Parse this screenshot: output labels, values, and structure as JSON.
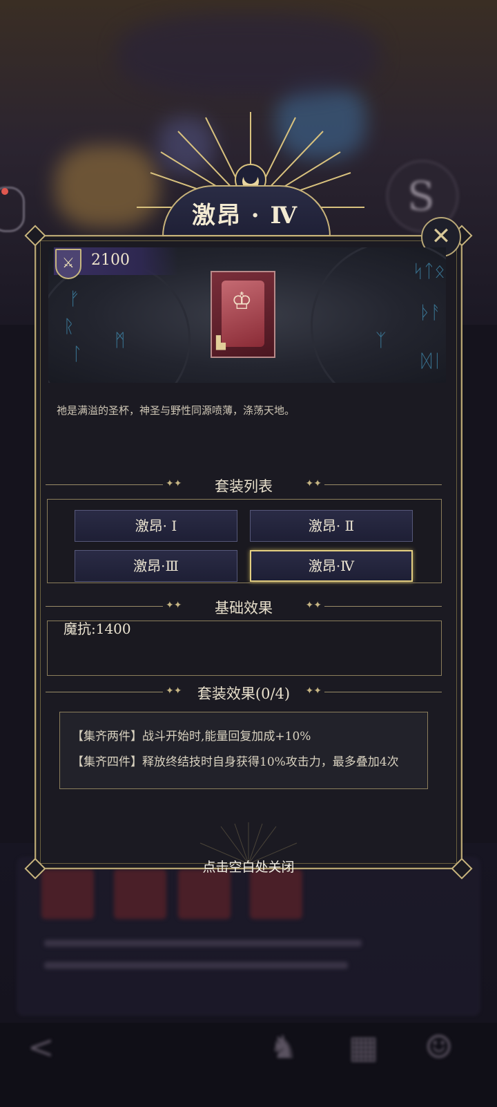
{
  "dialog": {
    "title": "激昂 · Ⅳ",
    "score": "2100",
    "description": "祂是满溢的圣杯，神圣与野性同源喷薄，涤荡天地。",
    "close_icon": "close-arrows-icon"
  },
  "set_list": {
    "heading": "套装列表",
    "items": [
      {
        "label": "激昂· Ⅰ"
      },
      {
        "label": "激昂· Ⅱ"
      },
      {
        "label": "激昂·Ⅲ"
      },
      {
        "label": "激昂·Ⅳ",
        "selected": true
      }
    ]
  },
  "base_effect": {
    "heading": "基础效果",
    "value": "魔抗:1400"
  },
  "set_effect": {
    "heading": "套装效果(0/4)",
    "lines": [
      "【集齐两件】战斗开始时,能量回复加成+10%",
      "【集齐四件】释放终结技时自身获得10%攻击力，最多叠加4次"
    ]
  },
  "close_hint": "点击空白处关闭",
  "colors": {
    "gold": "#c8b37a",
    "panel": "#1b1a22",
    "button": "#2a2b45",
    "selected_border": "#e4cf82"
  }
}
